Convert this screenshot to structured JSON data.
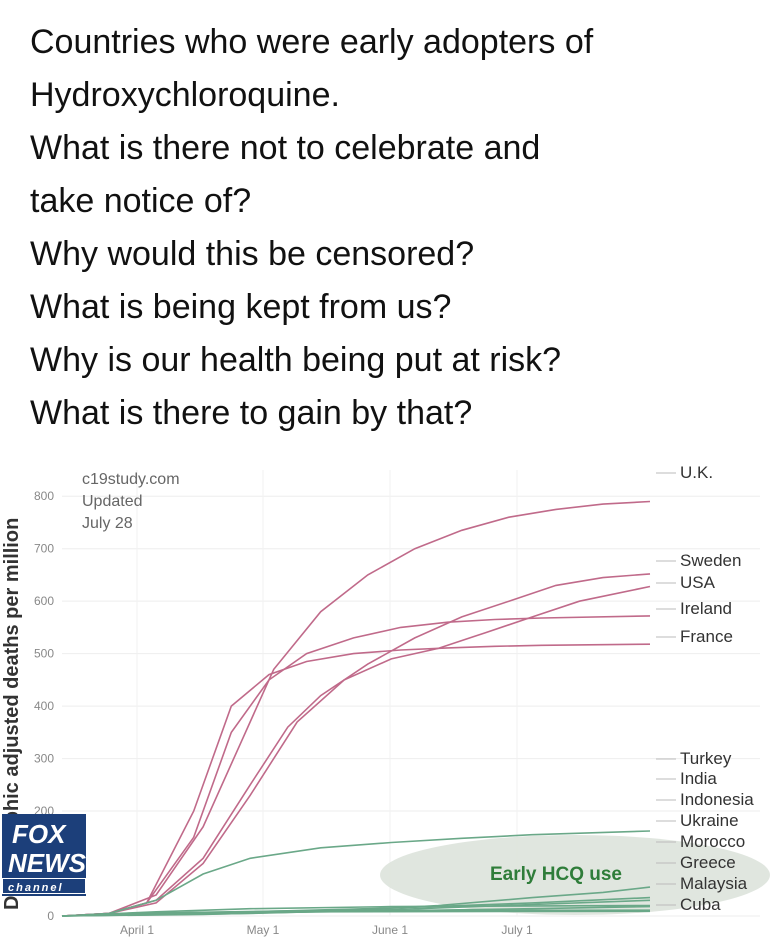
{
  "caption": {
    "lines": [
      "Countries who were early adopters of",
      "Hydroxychloroquine.",
      "What is there not to celebrate and",
      "take notice of?",
      "Why would this be censored?",
      "What is being kept from us?",
      "Why is our health being put at risk?",
      "What is there to gain by that?"
    ]
  },
  "chart_data": {
    "type": "line",
    "source": "c19study.com",
    "updated": "Updated",
    "updated_date": "July 28",
    "ylabel": "Demographic adjusted deaths per million",
    "ylim": [
      0,
      850
    ],
    "yticks": [
      0,
      200,
      300,
      400,
      500,
      600,
      700,
      800
    ],
    "xticks": [
      "April 1",
      "May 1",
      "June 1",
      "July 1"
    ],
    "annotation": "Early HCQ use",
    "grid": true,
    "series": [
      {
        "name": "U.K.",
        "color": "#c06a8a",
        "points": [
          [
            0,
            0
          ],
          [
            10,
            5
          ],
          [
            20,
            40
          ],
          [
            30,
            170
          ],
          [
            38,
            330
          ],
          [
            45,
            470
          ],
          [
            55,
            580
          ],
          [
            65,
            650
          ],
          [
            75,
            700
          ],
          [
            85,
            735
          ],
          [
            95,
            760
          ],
          [
            105,
            775
          ],
          [
            115,
            785
          ],
          [
            125,
            790
          ]
        ]
      },
      {
        "name": "Sweden",
        "color": "#c06a8a",
        "points": [
          [
            0,
            0
          ],
          [
            10,
            5
          ],
          [
            20,
            30
          ],
          [
            30,
            110
          ],
          [
            40,
            250
          ],
          [
            48,
            360
          ],
          [
            55,
            420
          ],
          [
            65,
            480
          ],
          [
            75,
            530
          ],
          [
            85,
            570
          ],
          [
            95,
            600
          ],
          [
            105,
            630
          ],
          [
            115,
            645
          ],
          [
            125,
            652
          ]
        ]
      },
      {
        "name": "USA",
        "color": "#c06a8a",
        "points": [
          [
            0,
            0
          ],
          [
            10,
            5
          ],
          [
            20,
            25
          ],
          [
            30,
            100
          ],
          [
            40,
            230
          ],
          [
            50,
            370
          ],
          [
            60,
            450
          ],
          [
            70,
            490
          ],
          [
            80,
            510
          ],
          [
            90,
            540
          ],
          [
            100,
            570
          ],
          [
            110,
            600
          ],
          [
            125,
            628
          ]
        ]
      },
      {
        "name": "Ireland",
        "color": "#c06a8a",
        "points": [
          [
            0,
            0
          ],
          [
            10,
            5
          ],
          [
            18,
            25
          ],
          [
            28,
            150
          ],
          [
            36,
            350
          ],
          [
            44,
            450
          ],
          [
            52,
            500
          ],
          [
            62,
            530
          ],
          [
            72,
            550
          ],
          [
            82,
            560
          ],
          [
            92,
            565
          ],
          [
            102,
            568
          ],
          [
            125,
            572
          ]
        ]
      },
      {
        "name": "France",
        "color": "#c06a8a",
        "points": [
          [
            0,
            0
          ],
          [
            10,
            5
          ],
          [
            18,
            25
          ],
          [
            28,
            200
          ],
          [
            36,
            400
          ],
          [
            44,
            460
          ],
          [
            52,
            485
          ],
          [
            62,
            500
          ],
          [
            72,
            507
          ],
          [
            82,
            511
          ],
          [
            92,
            514
          ],
          [
            102,
            516
          ],
          [
            125,
            518
          ]
        ]
      },
      {
        "name": "Turkey",
        "color": "#6aa888",
        "points": [
          [
            0,
            0
          ],
          [
            10,
            5
          ],
          [
            20,
            30
          ],
          [
            30,
            80
          ],
          [
            40,
            110
          ],
          [
            55,
            130
          ],
          [
            70,
            140
          ],
          [
            85,
            148
          ],
          [
            100,
            155
          ],
          [
            125,
            162
          ]
        ]
      },
      {
        "name": "India",
        "color": "#6aa888",
        "points": [
          [
            0,
            0
          ],
          [
            30,
            3
          ],
          [
            60,
            10
          ],
          [
            80,
            20
          ],
          [
            100,
            35
          ],
          [
            115,
            45
          ],
          [
            125,
            55
          ]
        ]
      },
      {
        "name": "Indonesia",
        "color": "#6aa888",
        "points": [
          [
            0,
            0
          ],
          [
            40,
            5
          ],
          [
            70,
            12
          ],
          [
            100,
            22
          ],
          [
            125,
            30
          ]
        ]
      },
      {
        "name": "Ukraine",
        "color": "#6aa888",
        "points": [
          [
            0,
            0
          ],
          [
            40,
            8
          ],
          [
            70,
            15
          ],
          [
            100,
            25
          ],
          [
            125,
            35
          ]
        ]
      },
      {
        "name": "Morocco",
        "color": "#6aa888",
        "points": [
          [
            0,
            0
          ],
          [
            40,
            6
          ],
          [
            70,
            10
          ],
          [
            100,
            14
          ],
          [
            125,
            18
          ]
        ]
      },
      {
        "name": "Greece",
        "color": "#6aa888",
        "points": [
          [
            0,
            0
          ],
          [
            20,
            8
          ],
          [
            40,
            14
          ],
          [
            70,
            18
          ],
          [
            125,
            20
          ]
        ]
      },
      {
        "name": "Malaysia",
        "color": "#6aa888",
        "points": [
          [
            0,
            0
          ],
          [
            20,
            6
          ],
          [
            50,
            10
          ],
          [
            125,
            11
          ]
        ]
      },
      {
        "name": "Cuba",
        "color": "#6aa888",
        "points": [
          [
            0,
            0
          ],
          [
            20,
            5
          ],
          [
            50,
            8
          ],
          [
            125,
            9
          ]
        ]
      }
    ]
  },
  "logo": {
    "line1": "FOX",
    "line2": "NEWS",
    "line3": "channel"
  }
}
